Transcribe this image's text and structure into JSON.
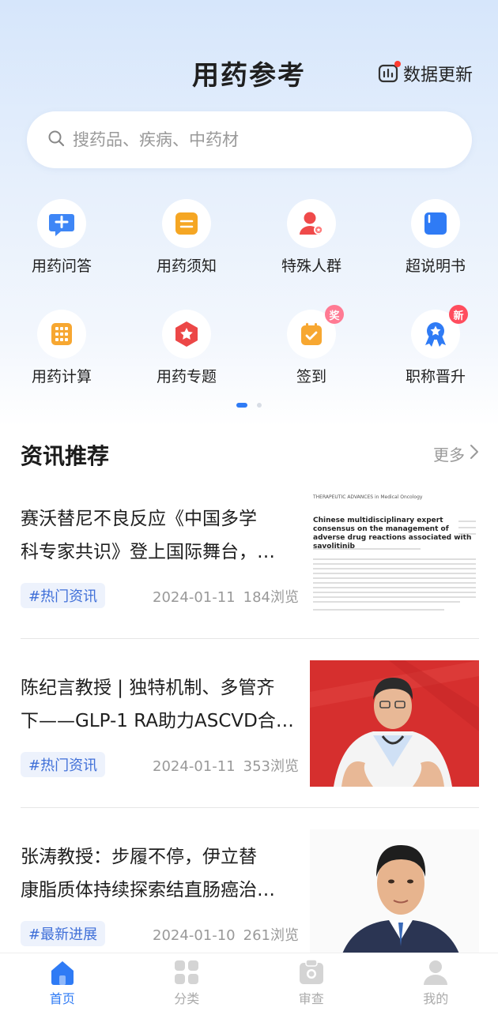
{
  "header": {
    "title": "用药参考",
    "data_update": "数据更新"
  },
  "search": {
    "placeholder": "搜药品、疾病、中药材"
  },
  "shortcuts": [
    {
      "label": "用药问答",
      "icon": "qa-chat-icon"
    },
    {
      "label": "用药须知",
      "icon": "notice-card-icon"
    },
    {
      "label": "特殊人群",
      "icon": "special-person-icon"
    },
    {
      "label": "超说明书",
      "icon": "book-icon"
    },
    {
      "label": "用药计算",
      "icon": "calculator-icon"
    },
    {
      "label": "用药专题",
      "icon": "topic-badge-icon"
    },
    {
      "label": "签到",
      "icon": "checkin-icon",
      "badge": "奖"
    },
    {
      "label": "职称晋升",
      "icon": "award-ribbon-icon",
      "badge": "新"
    }
  ],
  "news": {
    "section_title": "资讯推荐",
    "more": "更多",
    "items": [
      {
        "line1": "赛沃替尼不良反应《中国多学",
        "line2": "科专家共识》登上国际舞台，…",
        "tag": "#热门资讯",
        "date": "2024-01-11",
        "views": "184浏览",
        "thumb": {
          "journal": "THERAPEUTIC ADVANCES in Medical Oncology",
          "paper_title": "Chinese multidisciplinary expert consensus on the management of adverse drug reactions associated with savolitinib"
        }
      },
      {
        "line1": "陈纪言教授 | 独特机制、多管齐",
        "line2": "下——GLP-1 RA助力ASCVD合…",
        "tag": "#热门资讯",
        "date": "2024-01-11",
        "views": "353浏览"
      },
      {
        "line1": "张涛教授：步履不停，伊立替",
        "line2": "康脂质体持续探索结直肠癌治…",
        "tag": "#最新进展",
        "date": "2024-01-10",
        "views": "261浏览"
      }
    ]
  },
  "tabbar": [
    {
      "label": "首页",
      "active": true
    },
    {
      "label": "分类",
      "active": false
    },
    {
      "label": "审查",
      "active": false
    },
    {
      "label": "我的",
      "active": false
    }
  ],
  "colors": {
    "accent": "#2f7bf5",
    "tag_bg": "#edf2fc",
    "tag_text": "#3f6fd8",
    "badge_red": "#ff4d5e"
  }
}
